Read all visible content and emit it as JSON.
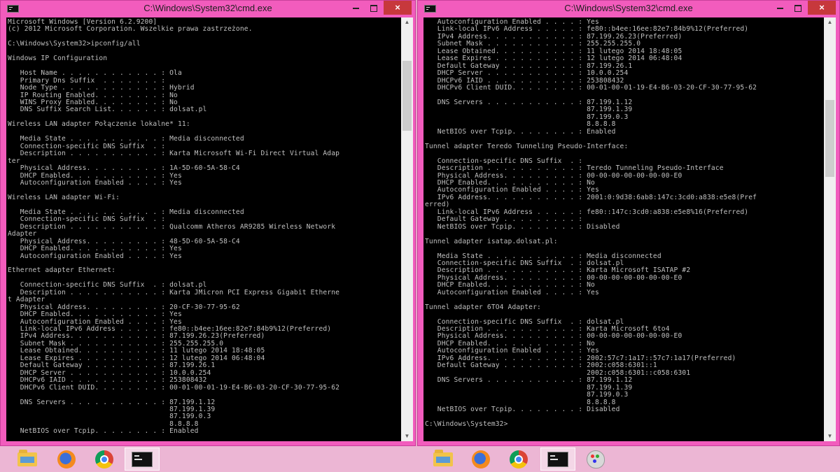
{
  "windows": [
    {
      "title": "C:\\Windows\\System32\\cmd.exe",
      "close_label": "×",
      "console_lines": [
        "Microsoft Windows [Version 6.2.9200]",
        "(c) 2012 Microsoft Corporation. Wszelkie prawa zastrzeżone.",
        "",
        "C:\\Windows\\System32>ipconfig/all",
        "",
        "Windows IP Configuration",
        "",
        "   Host Name . . . . . . . . . . . . : Ola",
        "   Primary Dns Suffix  . . . . . . . :",
        "   Node Type . . . . . . . . . . . . : Hybrid",
        "   IP Routing Enabled. . . . . . . . : No",
        "   WINS Proxy Enabled. . . . . . . . : No",
        "   DNS Suffix Search List. . . . . . : dolsat.pl",
        "",
        "Wireless LAN adapter Połączenie lokalne* 11:",
        "",
        "   Media State . . . . . . . . . . . : Media disconnected",
        "   Connection-specific DNS Suffix  . :",
        "   Description . . . . . . . . . . . : Karta Microsoft Wi-Fi Direct Virtual Adap",
        "ter",
        "   Physical Address. . . . . . . . . : 1A-5D-60-5A-58-C4",
        "   DHCP Enabled. . . . . . . . . . . : Yes",
        "   Autoconfiguration Enabled . . . . : Yes",
        "",
        "Wireless LAN adapter Wi-Fi:",
        "",
        "   Media State . . . . . . . . . . . : Media disconnected",
        "   Connection-specific DNS Suffix  . :",
        "   Description . . . . . . . . . . . : Qualcomm Atheros AR9285 Wireless Network",
        "Adapter",
        "   Physical Address. . . . . . . . . : 48-5D-60-5A-58-C4",
        "   DHCP Enabled. . . . . . . . . . . : Yes",
        "   Autoconfiguration Enabled . . . . : Yes",
        "",
        "Ethernet adapter Ethernet:",
        "",
        "   Connection-specific DNS Suffix  . : dolsat.pl",
        "   Description . . . . . . . . . . . : Karta JMicron PCI Express Gigabit Etherne",
        "t Adapter",
        "   Physical Address. . . . . . . . . : 20-CF-30-77-95-62",
        "   DHCP Enabled. . . . . . . . . . . : Yes",
        "   Autoconfiguration Enabled . . . . : Yes",
        "   Link-local IPv6 Address . . . . . : fe80::b4ee:16ee:82e7:84b9%12(Preferred)",
        "   IPv4 Address. . . . . . . . . . . : 87.199.26.23(Preferred)",
        "   Subnet Mask . . . . . . . . . . . : 255.255.255.0",
        "   Lease Obtained. . . . . . . . . . : 11 lutego 2014 18:48:05",
        "   Lease Expires . . . . . . . . . . : 12 lutego 2014 06:48:04",
        "   Default Gateway . . . . . . . . . : 87.199.26.1",
        "   DHCP Server . . . . . . . . . . . : 10.0.0.254",
        "   DHCPv6 IAID . . . . . . . . . . . : 253808432",
        "   DHCPv6 Client DUID. . . . . . . . : 00-01-00-01-19-E4-B6-03-20-CF-30-77-95-62",
        "",
        "   DNS Servers . . . . . . . . . . . : 87.199.1.12",
        "                                       87.199.1.39",
        "                                       87.199.0.3",
        "                                       8.8.8.8",
        "   NetBIOS over Tcpip. . . . . . . . : Enabled"
      ]
    },
    {
      "title": "C:\\Windows\\System32\\cmd.exe",
      "close_label": "×",
      "console_lines": [
        "   Autoconfiguration Enabled . . . . : Yes",
        "   Link-local IPv6 Address . . . . . : fe80::b4ee:16ee:82e7:84b9%12(Preferred)",
        "   IPv4 Address. . . . . . . . . . . : 87.199.26.23(Preferred)",
        "   Subnet Mask . . . . . . . . . . . : 255.255.255.0",
        "   Lease Obtained. . . . . . . . . . : 11 lutego 2014 18:48:05",
        "   Lease Expires . . . . . . . . . . : 12 lutego 2014 06:48:04",
        "   Default Gateway . . . . . . . . . : 87.199.26.1",
        "   DHCP Server . . . . . . . . . . . : 10.0.0.254",
        "   DHCPv6 IAID . . . . . . . . . . . : 253808432",
        "   DHCPv6 Client DUID. . . . . . . . : 00-01-00-01-19-E4-B6-03-20-CF-30-77-95-62",
        "",
        "   DNS Servers . . . . . . . . . . . : 87.199.1.12",
        "                                       87.199.1.39",
        "                                       87.199.0.3",
        "                                       8.8.8.8",
        "   NetBIOS over Tcpip. . . . . . . . : Enabled",
        "",
        "Tunnel adapter Teredo Tunneling Pseudo-Interface:",
        "",
        "   Connection-specific DNS Suffix  . :",
        "   Description . . . . . . . . . . . : Teredo Tunneling Pseudo-Interface",
        "   Physical Address. . . . . . . . . : 00-00-00-00-00-00-00-E0",
        "   DHCP Enabled. . . . . . . . . . . : No",
        "   Autoconfiguration Enabled . . . . : Yes",
        "   IPv6 Address. . . . . . . . . . . : 2001:0:9d38:6ab8:147c:3cd0:a838:e5e8(Pref",
        "erred)",
        "   Link-local IPv6 Address . . . . . : fe80::147c:3cd0:a838:e5e8%16(Preferred)",
        "   Default Gateway . . . . . . . . . :",
        "   NetBIOS over Tcpip. . . . . . . . : Disabled",
        "",
        "Tunnel adapter isatap.dolsat.pl:",
        "",
        "   Media State . . . . . . . . . . . : Media disconnected",
        "   Connection-specific DNS Suffix  . : dolsat.pl",
        "   Description . . . . . . . . . . . : Karta Microsoft ISATAP #2",
        "   Physical Address. . . . . . . . . : 00-00-00-00-00-00-00-E0",
        "   DHCP Enabled. . . . . . . . . . . : No",
        "   Autoconfiguration Enabled . . . . : Yes",
        "",
        "Tunnel adapter 6TO4 Adapter:",
        "",
        "   Connection-specific DNS Suffix  . : dolsat.pl",
        "   Description . . . . . . . . . . . : Karta Microsoft 6to4",
        "   Physical Address. . . . . . . . . : 00-00-00-00-00-00-00-E0",
        "   DHCP Enabled. . . . . . . . . . . : No",
        "   Autoconfiguration Enabled . . . . : Yes",
        "   IPv6 Address. . . . . . . . . . . : 2002:57c7:1a17::57c7:1a17(Preferred)",
        "   Default Gateway . . . . . . . . . : 2002:c058:6301::1",
        "                                       2002:c058:6301::c058:6301",
        "   DNS Servers . . . . . . . . . . . : 87.199.1.12",
        "                                       87.199.1.39",
        "                                       87.199.0.3",
        "                                       8.8.8.8",
        "   NetBIOS over Tcpip. . . . . . . . : Disabled",
        "",
        "C:\\Windows\\System32>"
      ]
    }
  ],
  "taskbar_left": [
    {
      "icon": "file-explorer-icon"
    },
    {
      "icon": "firefox-icon"
    },
    {
      "icon": "chrome-icon"
    },
    {
      "icon": "cmd-icon",
      "active": true
    }
  ],
  "taskbar_right": [
    {
      "icon": "file-explorer-icon"
    },
    {
      "icon": "firefox-icon"
    },
    {
      "icon": "chrome-icon"
    },
    {
      "icon": "cmd-icon",
      "active": true
    },
    {
      "icon": "paint-icon"
    }
  ],
  "colors": {
    "window_frame": "#f25cbd",
    "close_button": "#c7383c",
    "console_background": "#000000",
    "console_text": "#c0c0c0",
    "taskbar": "#ecb6d4"
  }
}
